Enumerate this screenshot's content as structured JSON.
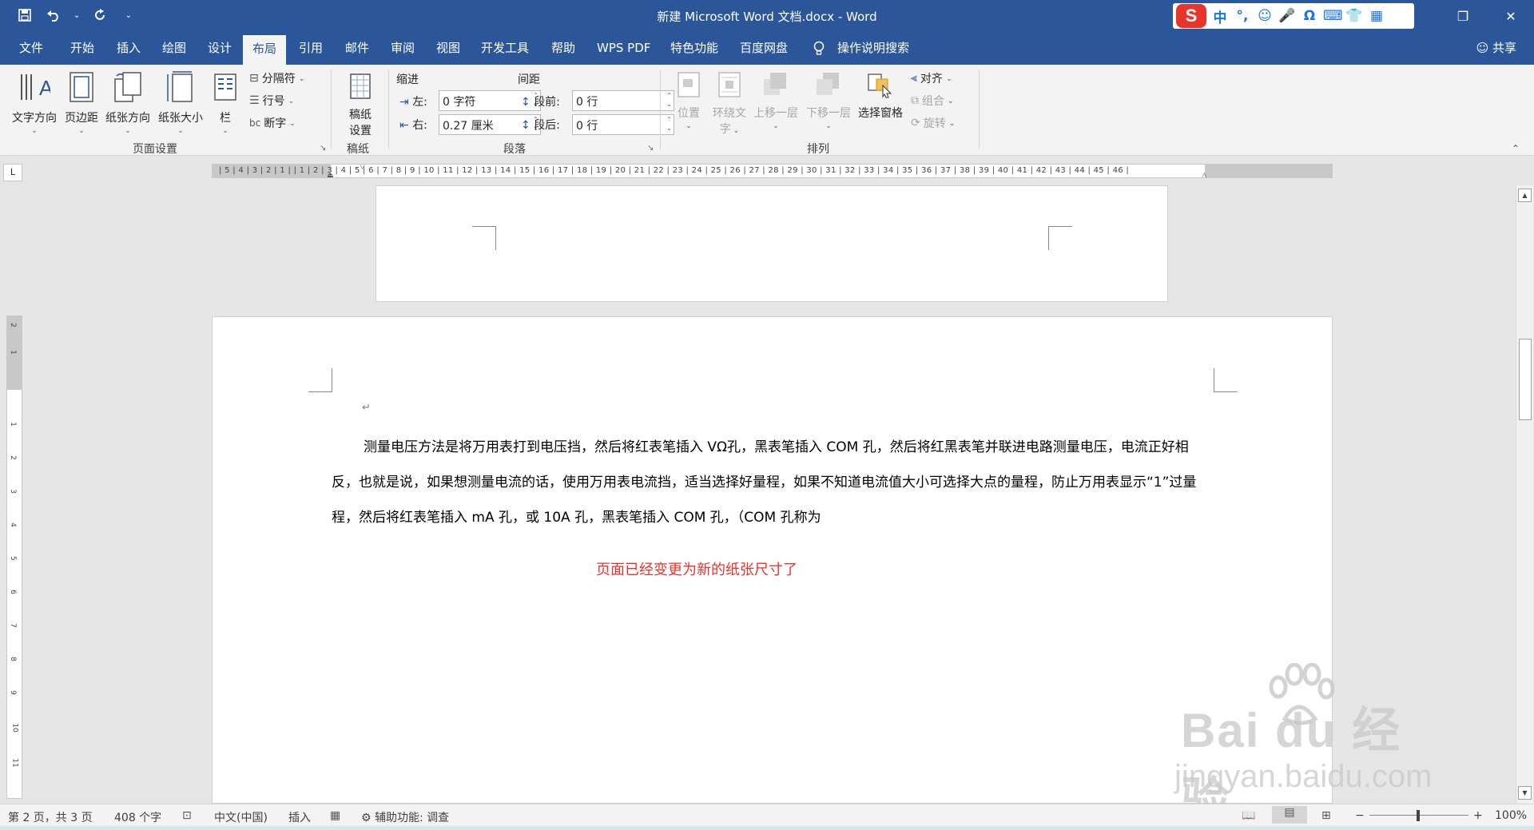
{
  "window": {
    "title": "新建 Microsoft Word 文档.docx  -  Word",
    "minimize": "—",
    "restore": "❐",
    "close": "✕"
  },
  "qat": {
    "save": "💾",
    "undo": "↶",
    "redo": "↻",
    "more": "⌄"
  },
  "ime": {
    "logo": "S",
    "items": [
      "中",
      "°,",
      "☺",
      "🎤",
      "Ω",
      "⌨",
      "👕",
      "▦"
    ]
  },
  "tabs": [
    "文件",
    "开始",
    "插入",
    "绘图",
    "设计",
    "布局",
    "引用",
    "邮件",
    "审阅",
    "视图",
    "开发工具",
    "帮助",
    "WPS PDF",
    "特色功能",
    "百度网盘",
    "操作说明搜索"
  ],
  "share": "共享",
  "ribbon": {
    "page_setup": {
      "text_direction": "文字方向",
      "margins": "页边距",
      "orientation": "纸张方向",
      "size": "纸张大小",
      "columns": "栏",
      "breaks": "分隔符",
      "line_numbers": "行号",
      "hyphenation": "断字",
      "label": "页面设置"
    },
    "manuscript": {
      "settings_line1": "稿纸",
      "settings_line2": "设置",
      "label": "稿纸"
    },
    "paragraph": {
      "indent_heading": "缩进",
      "spacing_heading": "间距",
      "left_label": "左:",
      "left_value": "0 字符",
      "right_label": "右:",
      "right_value": "0.27 厘米",
      "before_label": "段前:",
      "before_value": "0 行",
      "after_label": "段后:",
      "after_value": "0 行",
      "label": "段落"
    },
    "arrange": {
      "position": "位置",
      "wrap_text_line1": "环绕文",
      "wrap_text_line2": "字",
      "bring_forward": "上移一层",
      "send_backward": "下移一层",
      "selection_pane": "选择窗格",
      "align": "对齐",
      "group": "组合",
      "rotate": "旋转",
      "label": "排列"
    }
  },
  "ruler": {
    "corner": "L",
    "numbers": "| 5 | 4 | 3 | 2 | 1 |   | 1 | 2 | 3 | 4 | 5 | 6 | 7 | 8 | 9 | 10 | 11 | 12 | 13 | 14 | 15 | 16 | 17 | 18 | 19 | 20 | 21 | 22 | 23 | 24 | 25 | 26 | 27 | 28 | 29 | 30 | 31 | 32 | 33 | 34 | 35 | 36 | 37 | 38 | 39 | 40 | 41 | 42 | 43 | 44 | 45 | 46 |",
    "vnumbers": [
      "2",
      "1",
      "1",
      "1",
      "2",
      "3",
      "4",
      "5",
      "6",
      "7",
      "8",
      "9",
      "10",
      "11"
    ]
  },
  "document": {
    "para_mark": "↵",
    "paragraph": "测量电压方法是将万用表打到电压挡，然后将红表笔插入 VΩ孔，黑表笔插入 COM 孔，然后将红黑表笔并联进电路测量电压，电流正好相反，也就是说，如果想测量电流的话，使用万用表电流挡，适当选择好量程，如果不知道电流值大小可选择大点的量程，防止万用表显示“1”过量程，然后将红表笔插入 mA 孔，或 10A 孔，黑表笔插入 COM 孔，（COM 孔称为",
    "note": "页面已经变更为新的纸张尺寸了",
    "note_color": "#e8352c"
  },
  "statusbar": {
    "page": "第 2 页，共 3 页",
    "words": "408 个字",
    "language": "中文(中国)",
    "mode": "插入",
    "accessibility": "辅助功能: 调查",
    "zoom": "100%",
    "zoom_minus": "−",
    "zoom_plus": "+"
  },
  "watermark": {
    "brand": "Bai du 经验",
    "url": "jingyan.baidu.com"
  },
  "colors": {
    "accent": "#2b579a",
    "ribbon_bg": "#f3f3f3"
  }
}
